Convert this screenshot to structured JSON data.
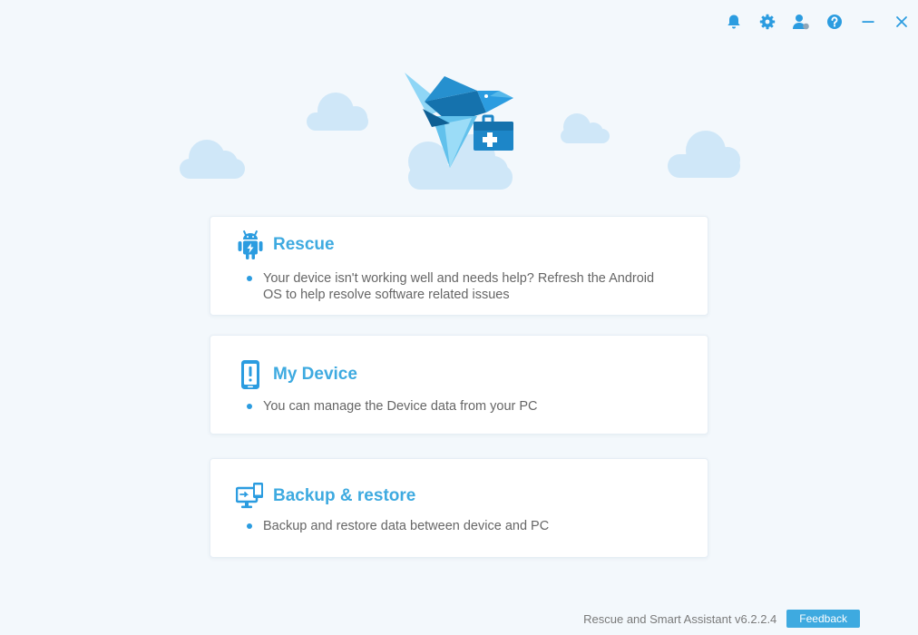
{
  "window": {
    "controls": [
      "bell-icon",
      "gear-icon",
      "account-icon",
      "help-icon",
      "minimize-icon",
      "close-icon"
    ]
  },
  "cards": {
    "rescue": {
      "title": "Rescue",
      "icon": "android-icon",
      "description": "Your device isn't working well and needs help? Refresh the Android OS to help resolve software related issues"
    },
    "my_device": {
      "title": "My Device",
      "icon": "phone-alert-icon",
      "description": "You can manage the Device data from your PC"
    },
    "backup": {
      "title": "Backup & restore",
      "icon": "monitor-sync-icon",
      "description": "Backup and restore data between device and PC"
    }
  },
  "footer": {
    "version": "Rescue and Smart Assistant v6.2.2.4",
    "feedback_label": "Feedback"
  },
  "colors": {
    "accent": "#3eaae0",
    "icon_blue": "#2b9ce0",
    "background": "#f3f8fc",
    "cloud": "#cfe7f8"
  }
}
